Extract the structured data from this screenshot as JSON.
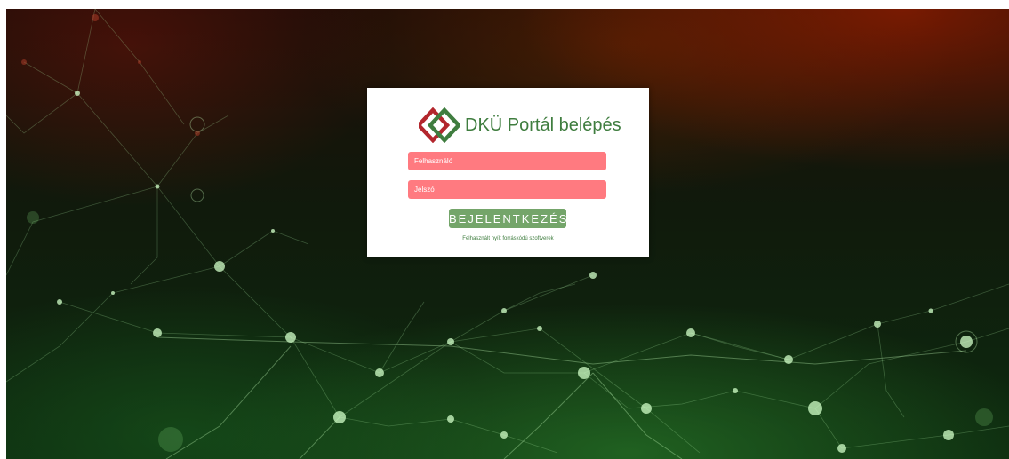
{
  "login": {
    "title": "DKÜ Portál belépés",
    "username_placeholder": "Felhasználó",
    "password_placeholder": "Jelszó",
    "submit_label": "BEJELENTKEZÉS",
    "footer_link": "Felhasznált nyílt forráskódú szoftverek"
  },
  "colors": {
    "brand_green": "#3f7d3f",
    "logo_red": "#b3262d",
    "input_fill": "#ff7a80",
    "button_fill": "#74a56a"
  },
  "icons": {
    "logo": "dku-diamond-logo-icon"
  }
}
